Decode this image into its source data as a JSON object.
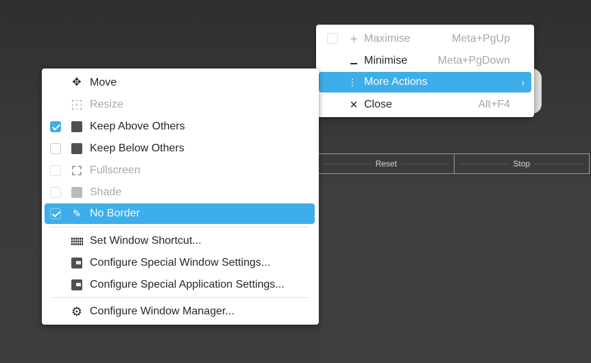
{
  "background": {
    "toolbar": {
      "reset_label": "Reset",
      "stop_label": "Stop"
    }
  },
  "colors": {
    "accent": "#3daee9",
    "menu_bg": "#ffffff",
    "disabled_text": "#a5a7a9",
    "desktop_bg": "#3a3a3a"
  },
  "top_menu": {
    "items": [
      {
        "label": "Maximise",
        "shortcut": "Meta+PgUp",
        "icon": "plus-icon",
        "disabled": true
      },
      {
        "label": "Minimise",
        "shortcut": "Meta+PgDown",
        "icon": "minus-icon",
        "disabled": false
      },
      {
        "label": "More Actions",
        "shortcut": "",
        "icon": "more-vertical-icon",
        "highlighted": true,
        "submenu": true
      },
      {
        "label": "Close",
        "shortcut": "Alt+F4",
        "icon": "close-icon",
        "disabled": false
      }
    ]
  },
  "main_menu": {
    "items": [
      {
        "label": "Move",
        "icon": "move-arrows-icon"
      },
      {
        "label": "Resize",
        "icon": "resize-icon",
        "disabled": true
      },
      {
        "label": "Keep Above Others",
        "icon": "window-icon",
        "checked": true
      },
      {
        "label": "Keep Below Others",
        "icon": "window-icon",
        "checked": false
      },
      {
        "label": "Fullscreen",
        "icon": "fullscreen-icon",
        "checked": false,
        "disabled": true
      },
      {
        "label": "Shade",
        "icon": "window-icon",
        "checked": false,
        "disabled": true
      },
      {
        "label": "No Border",
        "icon": "pencil-icon",
        "checked": true,
        "highlighted": true
      },
      {
        "label": "Set Window Shortcut...",
        "icon": "keyboard-icon"
      },
      {
        "label": "Configure Special Window Settings...",
        "icon": "window-settings-icon"
      },
      {
        "label": "Configure Special Application Settings...",
        "icon": "window-settings-icon"
      },
      {
        "label": "Configure Window Manager...",
        "icon": "gear-icon"
      }
    ]
  }
}
